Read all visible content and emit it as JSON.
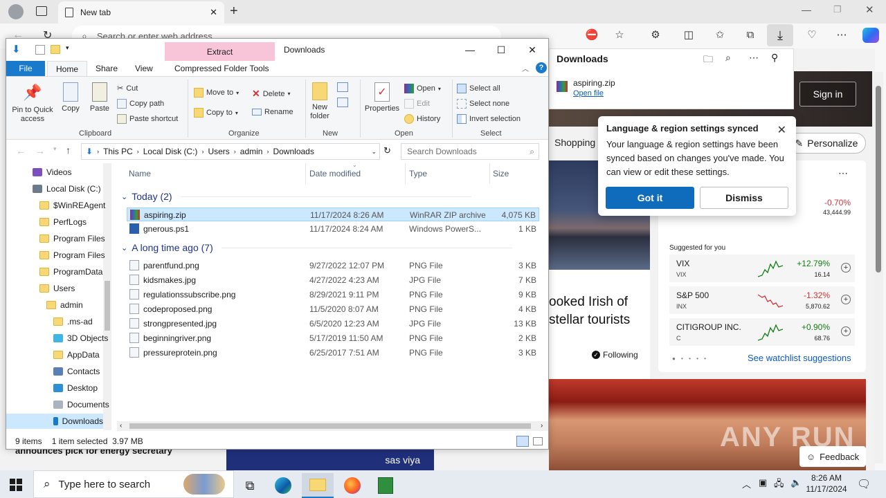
{
  "browser": {
    "tab_title": "New tab",
    "address_placeholder": "Search or enter web address"
  },
  "downloads_panel": {
    "title": "Downloads",
    "item_name": "aspiring.zip",
    "open_link": "Open file"
  },
  "sync_popup": {
    "title": "Language & region settings synced",
    "body": "Your language & region settings have been synced based on changes you've made. You can view or edit these settings.",
    "primary": "Got it",
    "secondary": "Dismiss"
  },
  "page": {
    "sign_in": "Sign in",
    "shopping": "Shopping",
    "personalize": "Personalize",
    "news_title": "ooked Irish of stellar tourists",
    "following": "Following",
    "suggested": "Suggested for you",
    "watchlist_link": "See watchlist suggestions",
    "bottom_news": "announces pick for energy secretary",
    "ad_brand": "sas viya",
    "feedback": "Feedback",
    "watermark": "ANY RUN",
    "top_stock": {
      "change": "-0.70%",
      "price": "43,444.99"
    },
    "stocks": [
      {
        "name": "VIX",
        "ticker": "VIX",
        "change": "+12.79%",
        "price": "16.14",
        "up": true
      },
      {
        "name": "S&P 500",
        "ticker": "INX",
        "change": "-1.32%",
        "price": "5,870.62",
        "up": false
      },
      {
        "name": "CITIGROUP INC.",
        "ticker": "C",
        "change": "+0.90%",
        "price": "68.76",
        "up": true
      }
    ],
    "up_color": "#107c10",
    "down_color": "#d13438"
  },
  "explorer": {
    "extract_tab": "Extract",
    "window_title": "Downloads",
    "tabs": {
      "file": "File",
      "home": "Home",
      "share": "Share",
      "view": "View",
      "compressed": "Compressed Folder Tools"
    },
    "ribbon": {
      "pin": "Pin to Quick access",
      "copy": "Copy",
      "paste": "Paste",
      "cut": "Cut",
      "copy_path": "Copy path",
      "paste_shortcut": "Paste shortcut",
      "clipboard": "Clipboard",
      "move_to": "Move to",
      "copy_to": "Copy to",
      "delete": "Delete",
      "rename": "Rename",
      "organize": "Organize",
      "new_folder": "New folder",
      "new": "New",
      "properties": "Properties",
      "open": "Open",
      "edit": "Edit",
      "history": "History",
      "open_group": "Open",
      "select_all": "Select all",
      "select_none": "Select none",
      "invert_selection": "Invert selection",
      "select": "Select"
    },
    "breadcrumb": [
      "This PC",
      "Local Disk (C:)",
      "Users",
      "admin",
      "Downloads"
    ],
    "search_placeholder": "Search Downloads",
    "nav": [
      {
        "label": "Videos",
        "indent": 0
      },
      {
        "label": "Local Disk (C:)",
        "indent": 0
      },
      {
        "label": "$WinREAgent",
        "indent": 1
      },
      {
        "label": "PerfLogs",
        "indent": 1
      },
      {
        "label": "Program Files",
        "indent": 1
      },
      {
        "label": "Program Files",
        "indent": 1
      },
      {
        "label": "ProgramData",
        "indent": 1
      },
      {
        "label": "Users",
        "indent": 1
      },
      {
        "label": "admin",
        "indent": 2
      },
      {
        "label": ".ms-ad",
        "indent": 3
      },
      {
        "label": "3D Objects",
        "indent": 3
      },
      {
        "label": "AppData",
        "indent": 3
      },
      {
        "label": "Contacts",
        "indent": 3
      },
      {
        "label": "Desktop",
        "indent": 3
      },
      {
        "label": "Documents",
        "indent": 3
      },
      {
        "label": "Downloads",
        "indent": 3
      }
    ],
    "columns": {
      "name": "Name",
      "date": "Date modified",
      "type": "Type",
      "size": "Size"
    },
    "groups": [
      {
        "label": "Today (2)",
        "files": [
          {
            "name": "aspiring.zip",
            "date": "11/17/2024 8:26 AM",
            "type": "WinRAR ZIP archive",
            "size": "4,075 KB",
            "selected": true
          },
          {
            "name": "gnerous.ps1",
            "date": "11/17/2024 8:24 AM",
            "type": "Windows PowerS...",
            "size": "1 KB"
          }
        ]
      },
      {
        "label": "A long time ago (7)",
        "files": [
          {
            "name": "parentfund.png",
            "date": "9/27/2022 12:07 PM",
            "type": "PNG File",
            "size": "3 KB"
          },
          {
            "name": "kidsmakes.jpg",
            "date": "4/27/2022 4:23 AM",
            "type": "JPG File",
            "size": "7 KB"
          },
          {
            "name": "regulationssubscribe.png",
            "date": "8/29/2021 9:11 PM",
            "type": "PNG File",
            "size": "9 KB"
          },
          {
            "name": "codeproposed.png",
            "date": "11/5/2020 8:07 AM",
            "type": "PNG File",
            "size": "4 KB"
          },
          {
            "name": "strongpresented.jpg",
            "date": "6/5/2020 12:23 AM",
            "type": "JPG File",
            "size": "13 KB"
          },
          {
            "name": "beginningriver.png",
            "date": "5/17/2019 11:50 AM",
            "type": "PNG File",
            "size": "2 KB"
          },
          {
            "name": "pressureprotein.png",
            "date": "6/25/2017 7:51 AM",
            "type": "PNG File",
            "size": "3 KB"
          }
        ]
      }
    ],
    "status": {
      "count": "9 items",
      "selection": "1 item selected  3.97 MB"
    }
  },
  "taskbar": {
    "search_placeholder": "Type here to search",
    "time": "8:26 AM",
    "date": "11/17/2024"
  }
}
